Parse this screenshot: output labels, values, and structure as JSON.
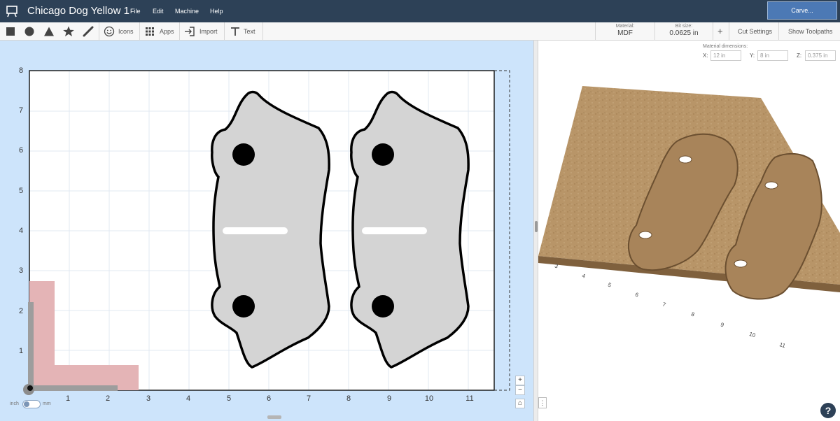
{
  "app": {
    "title": "Chicago Dog Yellow 1",
    "menus": [
      "File",
      "Edit",
      "Machine",
      "Help"
    ],
    "carve_label": "Carve..."
  },
  "toolbar": {
    "shape_tools": [
      "square-tool-icon",
      "circle-tool-icon",
      "triangle-tool-icon",
      "star-tool-icon",
      "pen-tool-icon"
    ],
    "icons_label": "Icons",
    "apps_label": "Apps",
    "import_label": "Import",
    "text_label": "Text",
    "material_caption": "Material:",
    "material_value": "MDF",
    "bit_caption": "Bit size:",
    "bit_value": "0.0625 in",
    "add_label": "+",
    "cut_settings_label": "Cut Settings",
    "show_toolpaths_label": "Show Toolpaths"
  },
  "canvas": {
    "x_ticks": [
      "1",
      "2",
      "3",
      "4",
      "5",
      "6",
      "7",
      "8",
      "9",
      "10",
      "11"
    ],
    "y_ticks": [
      "1",
      "2",
      "3",
      "4",
      "5",
      "6",
      "7",
      "8"
    ],
    "zoom_in": "+",
    "zoom_out": "−",
    "home": "⌂",
    "unit_inch": "inch",
    "unit_mm": "mm"
  },
  "preview": {
    "dimensions_caption": "Material dimensions:",
    "x_label": "X:",
    "x_value": "12 in",
    "y_label": "Y:",
    "y_value": "8 in",
    "z_label": "Z:",
    "z_value": "0.375 in",
    "axis_ticks": [
      "3",
      "4",
      "5",
      "6",
      "7",
      "8",
      "9",
      "10",
      "11"
    ],
    "menu_glyph": "⋮",
    "help_glyph": "?"
  },
  "colors": {
    "titlebar": "#2d4157",
    "carve_button": "#4c79b5",
    "canvas_bg": "#cde4fb",
    "part_fill": "#d4d4d4",
    "origin_marker": "#e4b4b6",
    "wood": "#b89568"
  }
}
